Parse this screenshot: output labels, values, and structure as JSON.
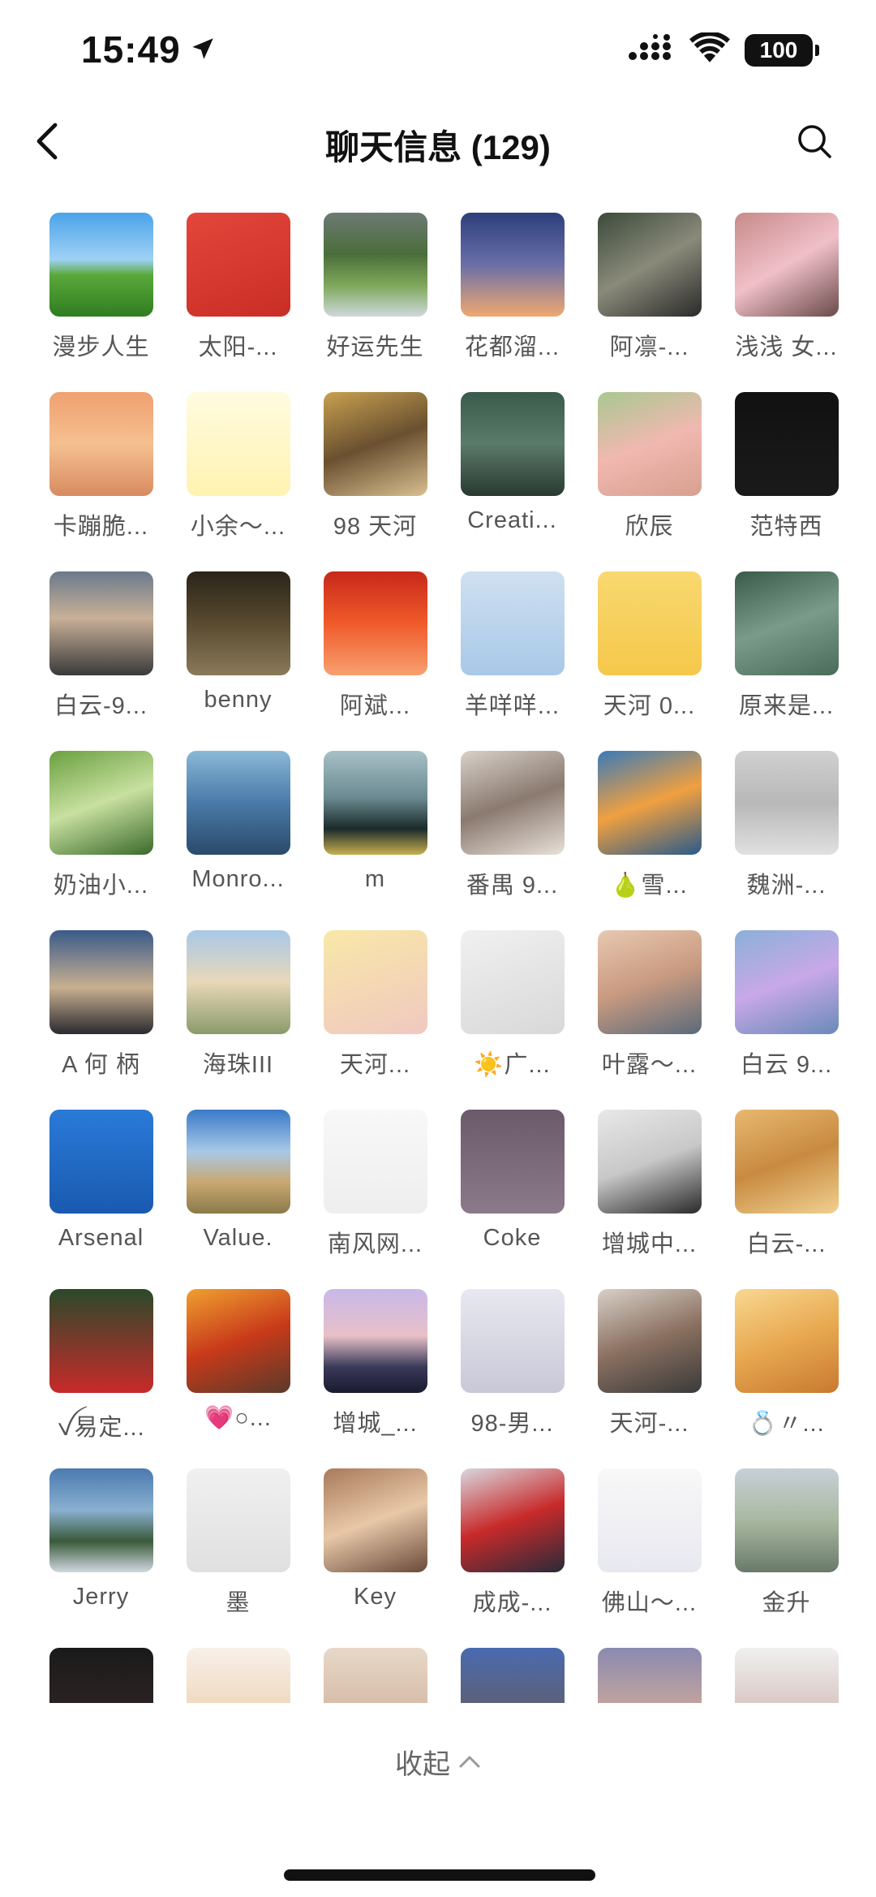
{
  "status": {
    "time": "15:49",
    "battery": "100"
  },
  "header": {
    "title": "聊天信息 (129)"
  },
  "members": [
    {
      "name": "漫步人生",
      "bg": "linear-gradient(180deg,#4aa3e8 0%,#9fd1f5 45%,#5aa83a 60%,#2f7d22 100%)"
    },
    {
      "name": "太阳-...",
      "bg": "linear-gradient(160deg,#e3463a,#c92e26)"
    },
    {
      "name": "好运先生",
      "bg": "linear-gradient(180deg,#6d7a74 0%,#4a6e3a 40%,#7ea85a 70%,#cfd8dc 100%)"
    },
    {
      "name": "花都溜...",
      "bg": "linear-gradient(180deg,#2d3e7a 0%,#6a6fa8 50%,#f0a870 100%)"
    },
    {
      "name": "阿凛-...",
      "bg": "linear-gradient(150deg,#3c4a3a,#8a8a7a,#2a2a2a)"
    },
    {
      "name": "浅浅 女...",
      "bg": "linear-gradient(150deg,#c78a8a,#f0c0c8,#6a4a4a)"
    },
    {
      "name": "卡蹦脆...",
      "bg": "linear-gradient(180deg,#f0a070,#f5c090,#d88a60)"
    },
    {
      "name": "小余～...",
      "bg": "linear-gradient(180deg,#fffbe0,#fff3b0)"
    },
    {
      "name": "98 天河",
      "bg": "linear-gradient(160deg,#c8a050,#6a5030,#d8c090)"
    },
    {
      "name": "Creati...",
      "bg": "linear-gradient(180deg,#3a5a4a,#5a7a6a,#2a3a30)"
    },
    {
      "name": "欣辰",
      "bg": "linear-gradient(160deg,#a8c890,#f0b8b0,#d8a090)"
    },
    {
      "name": "范特西",
      "bg": "linear-gradient(180deg,#111111,#1a1a1a)"
    },
    {
      "name": "白云-9...",
      "bg": "linear-gradient(180deg,#6a7a8a 0%,#c8b098 45%,#3a3a3a 100%)"
    },
    {
      "name": "benny",
      "bg": "linear-gradient(180deg,#2a2418,#5a4a30,#8a7a5a)"
    },
    {
      "name": "阿斌...",
      "bg": "linear-gradient(180deg,#c8281a,#f05a2a,#f8a070)"
    },
    {
      "name": "羊咩咩...",
      "bg": "linear-gradient(180deg,#cfe0f0,#a8c8e8)"
    },
    {
      "name": "天河 0...",
      "bg": "linear-gradient(180deg,#f8d870,#f5c84a)"
    },
    {
      "name": "原来是...",
      "bg": "linear-gradient(160deg,#3a5a4a,#7a9a8a,#4a6a5a)"
    },
    {
      "name": "奶油小...",
      "bg": "linear-gradient(160deg,#6aa040,#c8e0a0,#3a6a2a)"
    },
    {
      "name": "Monro...",
      "bg": "linear-gradient(180deg,#8ab8d8,#4a7aa8,#2a4a6a)"
    },
    {
      "name": "m",
      "bg": "linear-gradient(180deg,#a8c0c8 0%,#6a8a90 45%,#1a2a2a 75%,#c8b050 100%)"
    },
    {
      "name": "番禺 9...",
      "bg": "linear-gradient(160deg,#d8d0c8,#8a7a70,#e8e0d8)"
    },
    {
      "name": "🍐雪...",
      "bg": "linear-gradient(160deg,#3a7ab8,#f0a040,#2a5a8a)"
    },
    {
      "name": "魏洲-...",
      "bg": "linear-gradient(180deg,#d0d0d0,#b8b8b8,#e0e0e0)"
    },
    {
      "name": "A 何  柄",
      "bg": "linear-gradient(180deg,#3a5a8a 0%,#c8b090 55%,#2a2a30 100%)"
    },
    {
      "name": "海珠III",
      "bg": "linear-gradient(180deg,#a8c8e8 0%,#e8d8b8 50%,#8a9a6a 100%)"
    },
    {
      "name": "天河...",
      "bg": "linear-gradient(160deg,#f8e8a8,#f0c8c0)"
    },
    {
      "name": "☀️广...",
      "bg": "linear-gradient(160deg,#f0f0f0,#d8d8d8)"
    },
    {
      "name": "叶露～...",
      "bg": "linear-gradient(160deg,#e8c8b0,#c89a80,#5a6a7a)"
    },
    {
      "name": "白云 9...",
      "bg": "linear-gradient(160deg,#8ab0d8,#c8a8e8,#6a8ab8)"
    },
    {
      "name": "Arsenal",
      "bg": "linear-gradient(180deg,#2a7ad8,#1a5ab0)"
    },
    {
      "name": "Value.",
      "bg": "linear-gradient(180deg,#3a7ac8 0%,#a8c8e8 40%,#c8a870 70%,#8a7a4a 100%)"
    },
    {
      "name": "南风网...",
      "bg": "linear-gradient(180deg,#f8f8f8,#eeeeee)"
    },
    {
      "name": "Coke",
      "bg": "linear-gradient(180deg,#6a5a6a,#8a7a8a)"
    },
    {
      "name": "增城中...",
      "bg": "linear-gradient(160deg,#e8e8e8,#c8c8c8,#2a2a2a)"
    },
    {
      "name": "白云-...",
      "bg": "linear-gradient(160deg,#e8b870,#c88a40,#f0d090)"
    },
    {
      "name": "ꪜ易定...",
      "bg": "linear-gradient(180deg,#2a4a2a,#c82a2a)"
    },
    {
      "name": "💗○...",
      "bg": "linear-gradient(160deg,#f0a030,#c83a1a,#5a3a2a)"
    },
    {
      "name": "增城_...",
      "bg": "linear-gradient(180deg,#c8b8e8 0%,#e8c0c8 45%,#3a3a5a 75%,#1a1a30 100%)"
    },
    {
      "name": "98-男...",
      "bg": "linear-gradient(180deg,#e8e8f0,#c8c8d8)"
    },
    {
      "name": "天河-...",
      "bg": "linear-gradient(160deg,#d8d0c8,#8a7060,#3a3a3a)"
    },
    {
      "name": "💍〃...",
      "bg": "linear-gradient(160deg,#f8d890,#e8a850,#c87a30)"
    },
    {
      "name": "Jerry",
      "bg": "linear-gradient(180deg,#4a7ab0 0%,#8ab0d0 40%,#3a5a3a 70%,#d0d8e0 100%)"
    },
    {
      "name": "墨",
      "bg": "linear-gradient(180deg,#f0f0f0,#e0e0e0)"
    },
    {
      "name": "Key",
      "bg": "linear-gradient(160deg,#a87a5a,#e8c8a8,#6a4a3a)"
    },
    {
      "name": "成成-...",
      "bg": "linear-gradient(160deg,#d8d8e0,#c82a2a,#2a2a3a)"
    },
    {
      "name": "佛山～...",
      "bg": "linear-gradient(180deg,#f8f8f8,#e8e8f0)"
    },
    {
      "name": "金升",
      "bg": "linear-gradient(180deg,#c8d0d8 0%,#a8b8a0 50%,#6a7a6a 100%)"
    },
    {
      "name": "",
      "bg": "linear-gradient(180deg,#1a1a1a,#3a2a2a)"
    },
    {
      "name": "",
      "bg": "linear-gradient(180deg,#f8f0e8,#e8c8a0)"
    },
    {
      "name": "",
      "bg": "linear-gradient(180deg,#e8d8c8,#c8a890)"
    },
    {
      "name": "",
      "bg": "linear-gradient(180deg,#4a6ab0,#6a5a4a)"
    },
    {
      "name": "",
      "bg": "linear-gradient(180deg,#8a8ab0,#f0b890)"
    },
    {
      "name": "",
      "bg": "linear-gradient(180deg,#f0f0f0,#c8a8a0)"
    }
  ],
  "footer": {
    "collapse_label": "收起"
  }
}
